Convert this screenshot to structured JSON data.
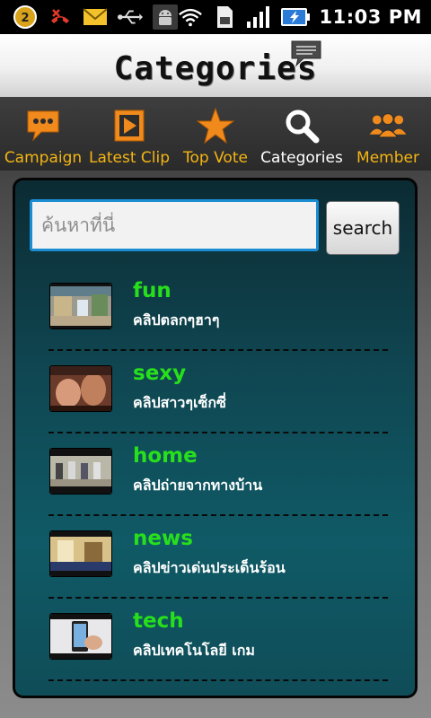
{
  "status_bar": {
    "time": "11:03 PM",
    "notification_count": "2",
    "icons": [
      "notification-badge-icon",
      "missed-call-icon",
      "mail-icon",
      "usb-icon",
      "android-debug-icon",
      "wifi-icon",
      "sd-card-icon",
      "signal-icon",
      "battery-charging-icon"
    ]
  },
  "header": {
    "title": "Categories",
    "icon": "chat-bubble-icon"
  },
  "nav": {
    "items": [
      {
        "label": "Campaign",
        "icon": "chat-bubble-icon"
      },
      {
        "label": "Latest Clip",
        "icon": "play-icon"
      },
      {
        "label": "Top Vote",
        "icon": "star-icon"
      },
      {
        "label": "Categories",
        "icon": "search-icon",
        "active": true
      },
      {
        "label": "Member",
        "icon": "members-icon"
      }
    ],
    "colors": {
      "label": "#f4b514",
      "active_label": "#ffffff",
      "icon": "#f08a1c"
    }
  },
  "search": {
    "placeholder": "ค้นหาที่นี่",
    "value": "",
    "button_label": "search"
  },
  "categories": [
    {
      "title": "fun",
      "subtitle": "คลิปตลกๆฮาๆ"
    },
    {
      "title": "sexy",
      "subtitle": "คลิปสาวๆเซ็กซี่"
    },
    {
      "title": "home",
      "subtitle": "คลิปถ่ายจากทางบ้าน"
    },
    {
      "title": "news",
      "subtitle": "คลิปข่าวเด่นประเด็นร้อน"
    },
    {
      "title": "tech",
      "subtitle": "คลิปเทคโนโลยี เกม"
    }
  ],
  "colors": {
    "category_title": "#27e01b",
    "search_border": "#1b8dd3"
  }
}
